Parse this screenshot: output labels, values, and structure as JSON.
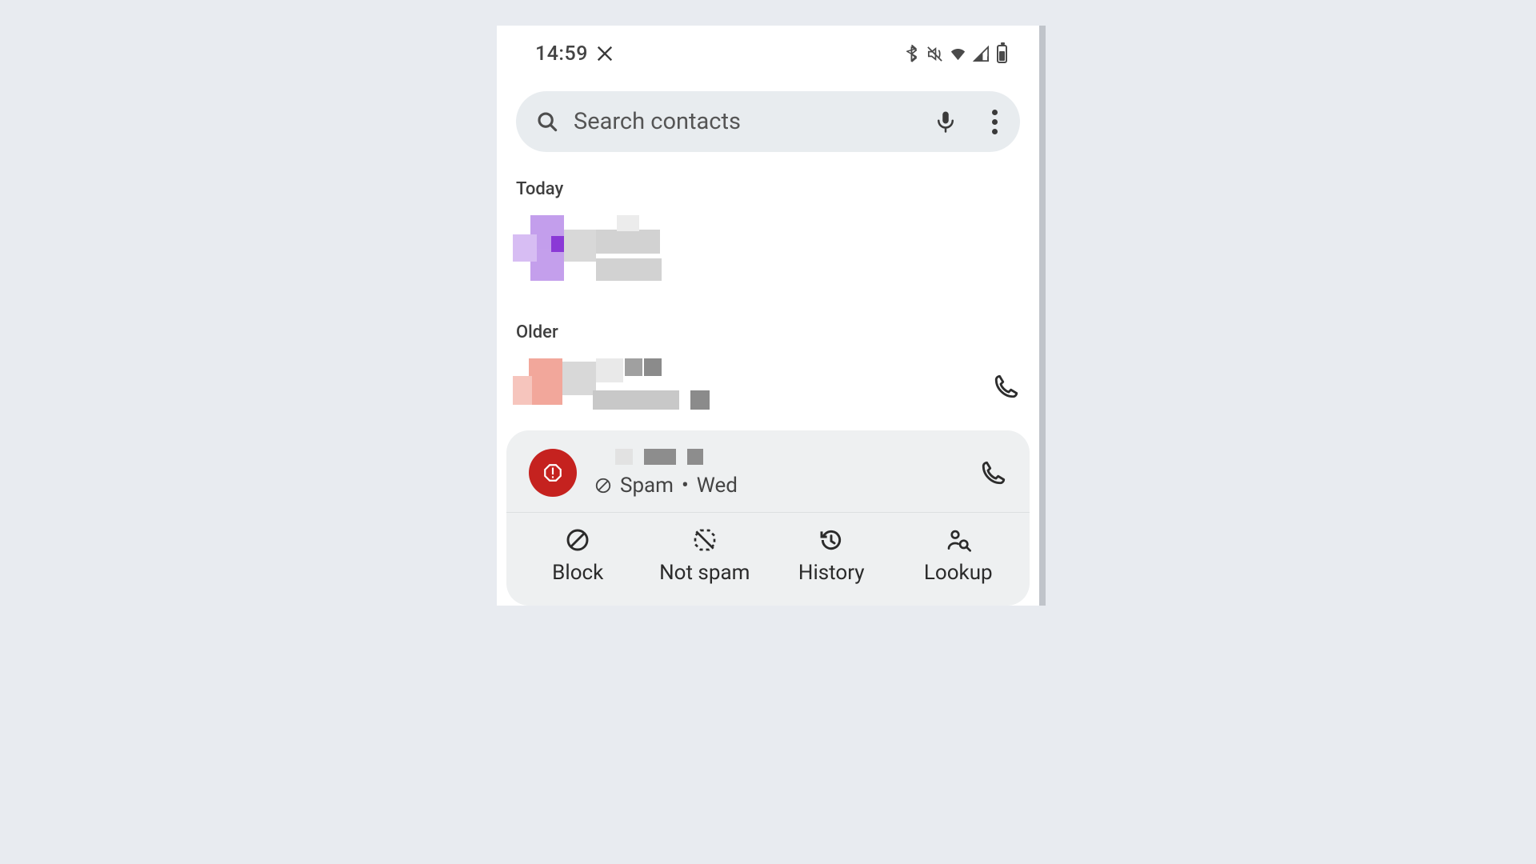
{
  "status_bar": {
    "time": "14:59"
  },
  "search": {
    "placeholder": "Search contacts"
  },
  "sections": {
    "today_header": "Today",
    "older_header": "Older"
  },
  "spam_card": {
    "subtitle_label": "Spam",
    "subtitle_separator": "•",
    "subtitle_day": "Wed",
    "actions": {
      "block": "Block",
      "not_spam": "Not spam",
      "history": "History",
      "lookup": "Lookup"
    }
  }
}
